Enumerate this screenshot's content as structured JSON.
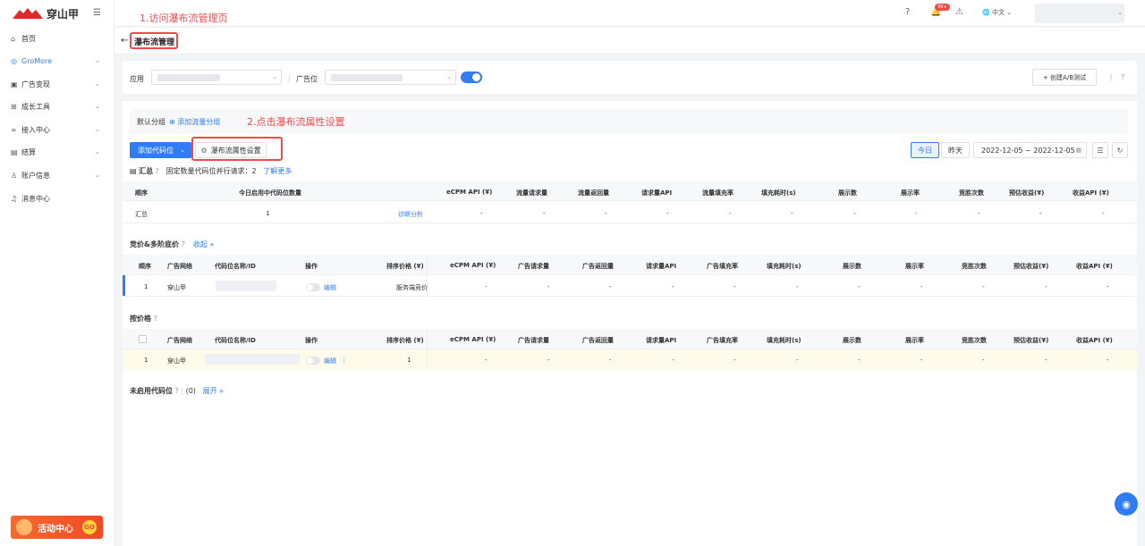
{
  "brand": {
    "name": "穿山甲"
  },
  "sidebar": {
    "items": [
      {
        "label": "首页",
        "icon": "home-icon"
      },
      {
        "label": "GroMore",
        "icon": "gromore-icon"
      },
      {
        "label": "广告变现",
        "icon": "ad-monetize-icon"
      },
      {
        "label": "成长工具",
        "icon": "grid-icon"
      },
      {
        "label": "接入中心",
        "icon": "link-icon"
      },
      {
        "label": "结算",
        "icon": "wallet-icon"
      },
      {
        "label": "账户信息",
        "icon": "user-icon"
      },
      {
        "label": "消息中心",
        "icon": "bell-icon"
      }
    ],
    "promo_label": "活动中心",
    "promo_go": "GO"
  },
  "annotations": {
    "step1": "1.访问瀑布流管理页",
    "step2": "2.点击瀑布流属性设置"
  },
  "topbar": {
    "badge": "99+",
    "lang": "中文"
  },
  "page": {
    "title": "瀑布流管理"
  },
  "filters": {
    "app_label": "应用",
    "adslot_label": "广告位",
    "create_ab": "+ 创建A/B测试"
  },
  "group": {
    "label": "默认分组",
    "add": "⊕ 添加流量分组"
  },
  "toolbar": {
    "add_code": "添加代码位",
    "attr_settings": "瀑布流属性设置",
    "today": "今日",
    "yesterday": "昨天",
    "date_range": "2022-12-05 ~ 2022-12-05"
  },
  "summary": {
    "title": "汇总",
    "fixed_text": "固定数量代码位并行请求：",
    "fixed_value": "2",
    "learn_more": "了解更多",
    "headers": [
      "顺序",
      "今日启用中代码位数量",
      "eCPM API (¥)",
      "流量请求量",
      "流量返回量",
      "请求量API",
      "流量填充率",
      "填充耗时(s)",
      "展示数",
      "展示率",
      "竞胜次数",
      "预估收益(¥)",
      "收益API (¥)"
    ],
    "row": {
      "order": "汇总",
      "count": "1",
      "diagnose": "诊断分析",
      "dash": "-"
    }
  },
  "bidding": {
    "title": "竞价&多阶底价",
    "collapse": "收起 »",
    "headers": [
      "顺序",
      "广告网络",
      "代码位名称/ID",
      "操作",
      "排序价格 (¥)",
      "eCPM API (¥)",
      "广告请求量",
      "广告返回量",
      "请求量API",
      "广告填充率",
      "填充耗时(s)",
      "展示数",
      "展示率",
      "竞胜次数",
      "预估收益(¥)",
      "收益API (¥)"
    ],
    "row": {
      "order": "1",
      "network": "穿山甲",
      "edit": "编辑",
      "price": "服务端竞价",
      "dash": "-"
    }
  },
  "byprice": {
    "title": "按价格",
    "headers": [
      "广告网络",
      "代码位名称/ID",
      "操作",
      "排序价格 (¥)",
      "eCPM API (¥)",
      "广告请求量",
      "广告返回量",
      "请求量API",
      "广告填充率",
      "填充耗时(s)",
      "展示数",
      "展示率",
      "竞胜次数",
      "预估收益(¥)",
      "收益API (¥)"
    ],
    "row": {
      "order": "1",
      "network": "穿山甲",
      "edit": "编辑",
      "price": "1",
      "dash": "-"
    }
  },
  "unused": {
    "title": "未启用代码位",
    "count": "(0)",
    "expand": "展开 »"
  },
  "colors": {
    "accent": "#2f7cf6",
    "annotation_red": "#f04a4a",
    "brand_red": "#e3262b"
  }
}
